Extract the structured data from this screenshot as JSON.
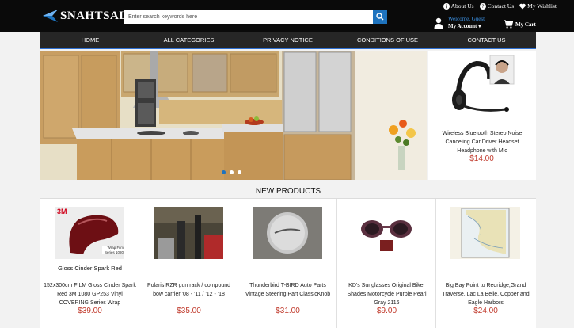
{
  "header": {
    "logo_text": "SNAHTSALE",
    "search_placeholder": "Enter search keywords here",
    "links": [
      "About Us",
      "Contact Us",
      "My Wishlist"
    ],
    "welcome": "Welcome, Guest",
    "my_account": "My Account",
    "cart": "My Cart"
  },
  "nav": {
    "items": [
      "HOME",
      "ALL CATEGORIES",
      "PRIVACY NOTICE",
      "CONDITIONS OF USE",
      "CONTACT US"
    ]
  },
  "banner": {
    "slides": 3,
    "active_slide": 1
  },
  "featured": {
    "title": "Wireless Bluetooth Stereo Noise Canceling Car Driver Headset Headphone with Mic",
    "price": "$14.00"
  },
  "new_products": {
    "heading": "NEW PRODUCTS",
    "items": [
      {
        "title": "152x300cm FILM Gloss Cinder Spark Red 3M 1080 GP253 Vinyl COVERING Series Wrap",
        "price": "$39.00",
        "image_caption": "Gloss Cinder Spark Red",
        "brand": "3M",
        "tag": "Wrap Film Series 1080"
      },
      {
        "title": "Polaris RZR gun rack / compound bow carrier '08 - '11 / '12 - '18",
        "price": "$35.00"
      },
      {
        "title": "Thunderbird T-BIRD Auto Parts Vintage Steering Part ClassicKnob",
        "price": "$31.00"
      },
      {
        "title": "KD's Sunglasses Original Biker Shades Motorcycle Purple Pearl Gray 2116",
        "price": "$9.00"
      },
      {
        "title": "Big Bay Point to Redridge;Grand Traverse, Lac La Belle, Copper and Eagle Harbors",
        "price": "$24.00"
      }
    ]
  },
  "colors": {
    "accent": "#1e73be",
    "price": "#c0392b",
    "header_bg": "#0a0a0a",
    "nav_bg": "#262626"
  }
}
